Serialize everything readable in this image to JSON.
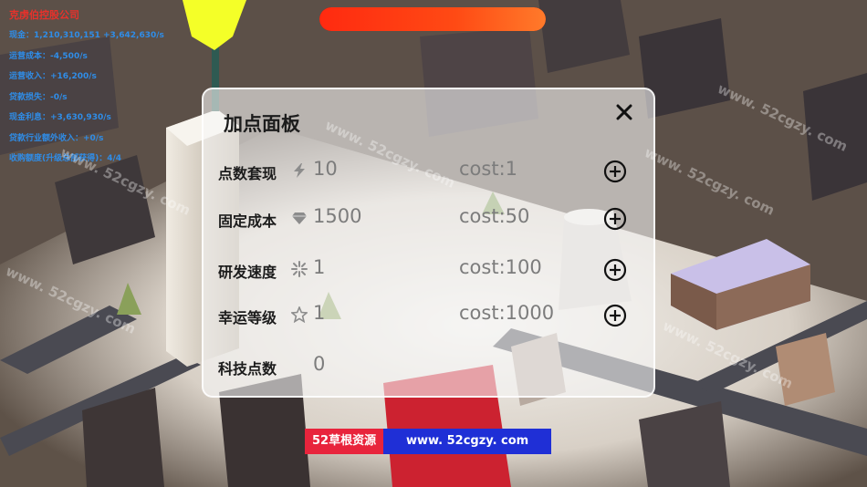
{
  "stats": {
    "company": "克虏伯控股公司",
    "rows": [
      "现金：1,210,310,151 +3,642,630/s",
      "运营成本：-4,500/s",
      "运营收入：+16,200/s",
      "贷款损失：-0/s",
      "现金利息：+3,630,930/s",
      "贷款行业额外收入：+0/s",
      "收购额度(升级总部获得)：4/4"
    ]
  },
  "progress": {
    "fraction": 1.0
  },
  "panel": {
    "title": "加点面板",
    "close_icon": "close-x-icon",
    "rows": [
      {
        "label": "点数套现",
        "icon": "lightning-icon",
        "value": "10",
        "cost": "cost:1",
        "has_plus": true
      },
      {
        "label": "固定成本",
        "icon": "diamond-icon",
        "value": "1500",
        "cost": "cost:50",
        "has_plus": true
      },
      {
        "label": "研发速度",
        "icon": "sparkle-icon",
        "value": "1",
        "cost": "cost:100",
        "has_plus": true
      },
      {
        "label": "幸运等级",
        "icon": "star-icon",
        "value": "1",
        "cost": "cost:1000",
        "has_plus": true
      },
      {
        "label": "科技点数",
        "icon": "",
        "value": "0",
        "cost": "",
        "has_plus": false
      }
    ]
  },
  "watermark": {
    "left": "52草根资源",
    "right": "www. 52cgzy. com",
    "tiles": [
      "www. 52cgzy. com",
      "www. 52cgzy. com",
      "www. 52cgzy. com",
      "www. 52cgzy. com",
      "www. 52cgzy. com",
      "www. 52cgzy. com"
    ]
  },
  "colors": {
    "company": "#e8312b",
    "stats": "#2f8de8",
    "progress": "#ff3a12",
    "wm_left": "#e8243c",
    "wm_right": "#1f2fd6"
  }
}
